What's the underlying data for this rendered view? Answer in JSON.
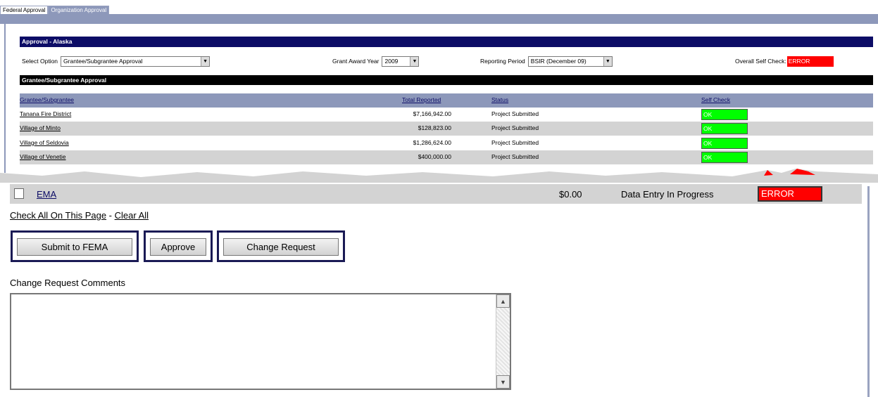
{
  "tabs": [
    "Federal Approval",
    "Organization Approval"
  ],
  "approval_header": "Approval - Alaska",
  "options": {
    "select_option_label": "Select Option",
    "select_option_value": "Grantee/Subgrantee Approval",
    "grant_year_label": "Grant Award Year",
    "grant_year_value": "2009",
    "reporting_period_label": "Reporting Period",
    "reporting_period_value": "BSIR (December 09)",
    "overall_self_check_label": "Overall Self Check:",
    "overall_self_check_value": "ERROR"
  },
  "section_header": "Grantee/Subgrantee Approval",
  "columns": [
    "Grantee/Subgrantee",
    "Total Reported",
    "Status",
    "Self Check"
  ],
  "rows": [
    {
      "name": "Tanana Fire District",
      "total": "$7,166,942.00",
      "status": "Project Submitted",
      "check": "OK"
    },
    {
      "name": "Village of Minto",
      "total": "$128,823.00",
      "status": "Project Submitted",
      "check": "OK"
    },
    {
      "name": "Village of Seldovia",
      "total": "$1,286,624.00",
      "status": "Project Submitted",
      "check": "OK"
    },
    {
      "name": "Village of Venetie",
      "total": "$400,000.00",
      "status": "Project Submitted",
      "check": "OK"
    }
  ],
  "ema_row": {
    "name": "EMA",
    "total": "$0.00",
    "status": "Data Entry In Progress",
    "check": "ERROR"
  },
  "links": {
    "check_all": "Check All On This Page",
    "separator": " - ",
    "clear_all": "Clear All"
  },
  "buttons": {
    "submit": "Submit to FEMA",
    "approve": "Approve",
    "change_request": "Change Request"
  },
  "comments_label": "Change Request Comments",
  "colors": {
    "navy": "#0c0c66",
    "slate": "#8d98ba",
    "ok_green": "#00ff00",
    "error_red": "#ff0000",
    "row_gray": "#d3d3d3"
  },
  "icons": {
    "dropdown": "chevron-down-icon",
    "scroll_up": "arrow-up-icon",
    "scroll_down": "arrow-down-icon"
  }
}
